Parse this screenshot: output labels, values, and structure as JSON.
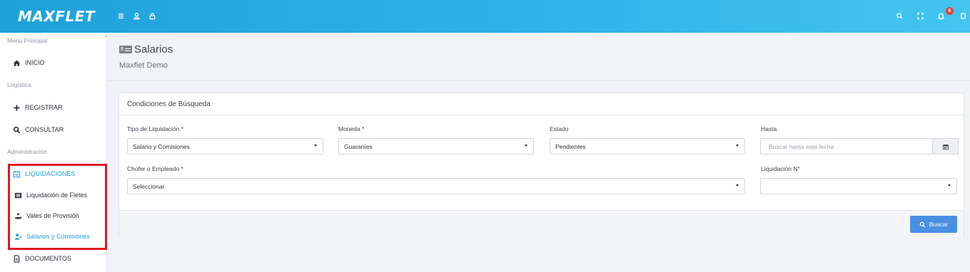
{
  "app": {
    "logo": "MAXFLET",
    "notification_count": "6"
  },
  "topbar": {
    "left_icons": [
      "menu-icon",
      "user-icon",
      "lock-icon"
    ],
    "right_icons": [
      "search-icon",
      "fullscreen-icon",
      "bell-icon",
      "panel-icon"
    ]
  },
  "sidebar": {
    "sections": {
      "menu_principal": "Menu Principal",
      "logistica": "Logística",
      "administracion": "Administración"
    },
    "items": {
      "inicio": "INICIO",
      "registrar": "REGISTRAR",
      "consultar": "CONSULTAR",
      "liquidaciones": "LIQUIDACIONES",
      "liquidacion_fletes": "Liquidación de Fletes",
      "vales_provision": "Vales de Provisión",
      "salarios_comisiones": "Salarios y Comisiones",
      "documentos": "DOCUMENTOS"
    }
  },
  "header": {
    "title": "Salarios",
    "subtitle": "Maxflet Demo",
    "icon_text": "$"
  },
  "panel": {
    "title": "Condiciones de Búsqueda",
    "tipo_label": "Tipo de Liquidación *",
    "tipo_value": "Salario y Comisiones",
    "moneda_label": "Moneda *",
    "moneda_value": "Guaraníes",
    "estado_label": "Estado",
    "estado_value": "Pendientes",
    "hasta_label": "Hasta",
    "hasta_placeholder": "Buscar hasta esta fecha",
    "chofer_label": "Chofer o Empleado *",
    "chofer_value": "Seleccionar",
    "liq_label": "Liquidación N°",
    "liq_value": "",
    "search_button": "Buscar"
  },
  "colors": {
    "topbar": "#2eb3e8",
    "accent": "#1ea1d9",
    "button": "#4a90e2",
    "highlight_box": "#e0191f"
  }
}
